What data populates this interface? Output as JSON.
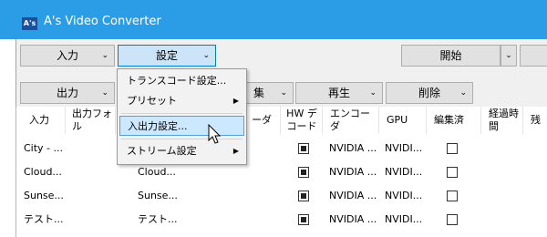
{
  "window": {
    "title": "A's Video Converter",
    "logo_text": "A's"
  },
  "toolbar1": {
    "input_label": "入力",
    "settings_label": "設定",
    "start_label": "開始"
  },
  "toolbar2": {
    "output_label": "出力",
    "edit_label": "集",
    "play_label": "再生",
    "delete_label": "削除"
  },
  "menu": {
    "items": [
      {
        "label": "トランスコード設定...",
        "submenu": false
      },
      {
        "label": "プリセット",
        "submenu": true
      },
      {
        "label": "入出力設定...",
        "submenu": false,
        "highlighted": true
      },
      {
        "label": "ストリーム設定",
        "submenu": true
      }
    ]
  },
  "table": {
    "columns": [
      "入力",
      "出力フォル",
      "ーダ",
      "HW デコード",
      "エンコーダ",
      "GPU",
      "編集済",
      "経過時間",
      "残"
    ],
    "rows": [
      {
        "input": "City - ...",
        "output": "",
        "hw": true,
        "encoder": "NVIDIA ...",
        "gpu": "NVIDI...",
        "edited": false
      },
      {
        "input": "Cloud...",
        "output": "Cloud...",
        "hw": true,
        "encoder": "NVIDIA ...",
        "gpu": "NVIDI...",
        "edited": false
      },
      {
        "input": "Sunse...",
        "output": "Sunse...",
        "hw": true,
        "encoder": "NVIDIA ...",
        "gpu": "NVIDI...",
        "edited": false
      },
      {
        "input": "テスト...",
        "output": "テスト...",
        "hw": true,
        "encoder": "NVIDIA ...",
        "gpu": "NVIDI...",
        "edited": false
      }
    ]
  },
  "colors": {
    "titlebar": "#2b9de6",
    "menu_highlight": "#cce8ff",
    "button_active": "#cce4f7"
  }
}
